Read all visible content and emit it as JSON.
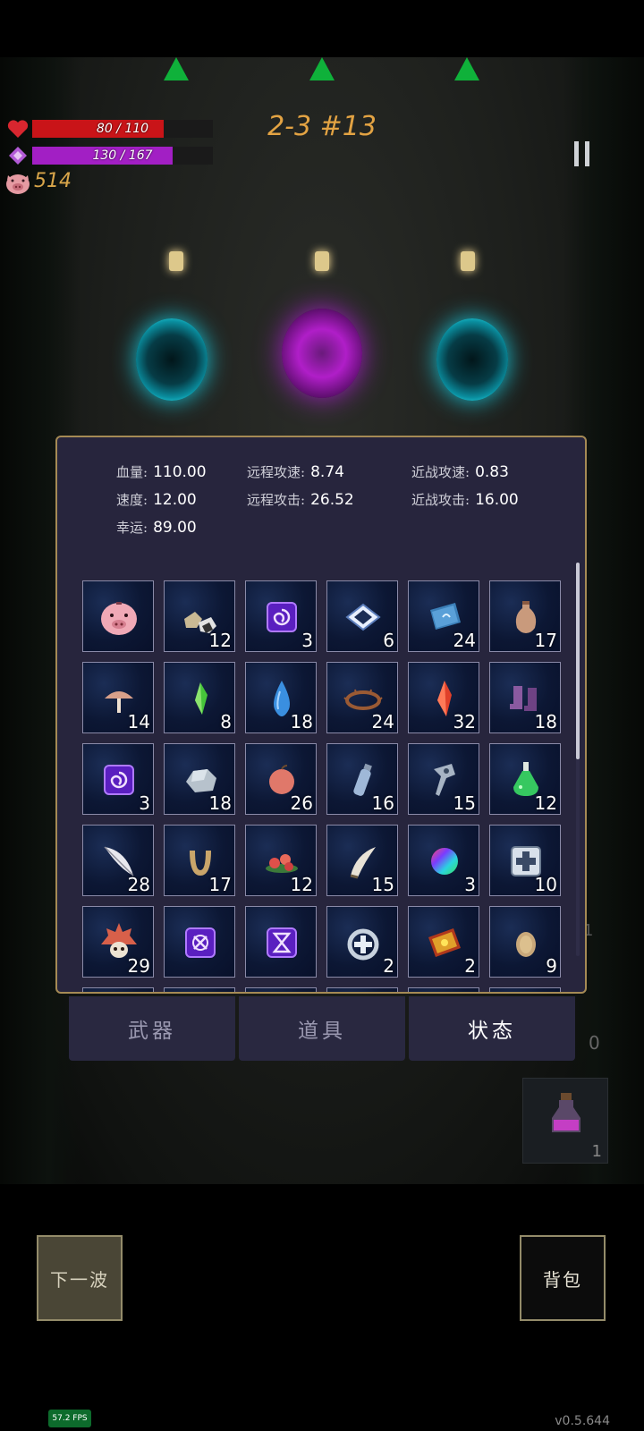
{
  "hud": {
    "hp_text": "80 / 110",
    "hp_fraction": 0.727,
    "hp_color": "#c91418",
    "mp_text": "130 / 167",
    "mp_fraction": 0.778,
    "mp_color": "#a21fc4",
    "gold": "514",
    "wave": "2-3 #13"
  },
  "stats": {
    "hp_label": "血量:",
    "hp_value": "110.00",
    "ranged_speed_label": "远程攻速:",
    "ranged_speed_value": "8.74",
    "melee_speed_label": "近战攻速:",
    "melee_speed_value": "0.83",
    "speed_label": "速度:",
    "speed_value": "12.00",
    "ranged_attack_label": "远程攻击:",
    "ranged_attack_value": "26.52",
    "melee_attack_label": "近战攻击:",
    "melee_attack_value": "16.00",
    "luck_label": "幸运:",
    "luck_value": "89.00"
  },
  "items": [
    {
      "icon": "piggy-bank-icon",
      "count": ""
    },
    {
      "icon": "ore-rocks-icon",
      "count": "12"
    },
    {
      "icon": "purple-swirl-rune-icon",
      "count": "3"
    },
    {
      "icon": "diamond-tile-icon",
      "count": "6"
    },
    {
      "icon": "spell-book-icon",
      "count": "24"
    },
    {
      "icon": "clay-vase-icon",
      "count": "17"
    },
    {
      "icon": "mushroom-icon",
      "count": "14"
    },
    {
      "icon": "green-crystal-icon",
      "count": "8"
    },
    {
      "icon": "water-drop-icon",
      "count": "18"
    },
    {
      "icon": "thorn-crown-icon",
      "count": "24"
    },
    {
      "icon": "red-crystal-icon",
      "count": "32"
    },
    {
      "icon": "boots-icon",
      "count": "18"
    },
    {
      "icon": "purple-swirl-rune-icon",
      "count": "3"
    },
    {
      "icon": "gray-stone-icon",
      "count": "18"
    },
    {
      "icon": "peach-icon",
      "count": "26"
    },
    {
      "icon": "bottle-icon",
      "count": "16"
    },
    {
      "icon": "hammer-icon",
      "count": "15"
    },
    {
      "icon": "green-potion-icon",
      "count": "12"
    },
    {
      "icon": "feather-icon",
      "count": "28"
    },
    {
      "icon": "horseshoe-icon",
      "count": "17"
    },
    {
      "icon": "red-flowers-icon",
      "count": "12"
    },
    {
      "icon": "horn-icon",
      "count": "15"
    },
    {
      "icon": "rainbow-orb-icon",
      "count": "3"
    },
    {
      "icon": "medkit-icon",
      "count": "10"
    },
    {
      "icon": "spiked-skull-icon",
      "count": "29"
    },
    {
      "icon": "purple-x-rune-icon",
      "count": ""
    },
    {
      "icon": "hourglass-rune-icon",
      "count": ""
    },
    {
      "icon": "heal-ring-icon",
      "count": "2"
    },
    {
      "icon": "red-tome-icon",
      "count": "2"
    },
    {
      "icon": "egg-icon",
      "count": "9"
    }
  ],
  "tabs": {
    "weapons": "武器",
    "items": "道具",
    "status": "状态"
  },
  "buttons": {
    "next_wave": "下一波",
    "backpack": "背包"
  },
  "side": {
    "slot_count_1": "1",
    "slot_count_0": "0",
    "potion_count": "1"
  },
  "fps": "57.2 FPS",
  "version": "v0.5.644"
}
